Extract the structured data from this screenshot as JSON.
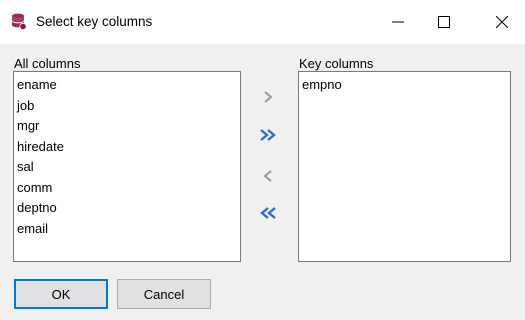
{
  "window": {
    "title": "Select key columns",
    "icon": "database-icon",
    "controls": [
      "minimize-icon",
      "maximize-icon",
      "close-icon"
    ]
  },
  "all_columns": {
    "label": "All columns",
    "items": [
      "ename",
      "job",
      "mgr",
      "hiredate",
      "sal",
      "comm",
      "deptno",
      "email"
    ]
  },
  "key_columns": {
    "label": "Key columns",
    "items": [
      "empno"
    ]
  },
  "move_buttons": {
    "right": "chevron-right-icon",
    "all_right": "double-chevron-right-icon",
    "left": "chevron-left-icon",
    "all_left": "double-chevron-left-icon"
  },
  "buttons": {
    "ok": "OK",
    "cancel": "Cancel"
  },
  "colors": {
    "accent": "#2f6fd0",
    "disabled_arrow": "#9a9a9a",
    "icon_maroon": "#9b2a52"
  }
}
